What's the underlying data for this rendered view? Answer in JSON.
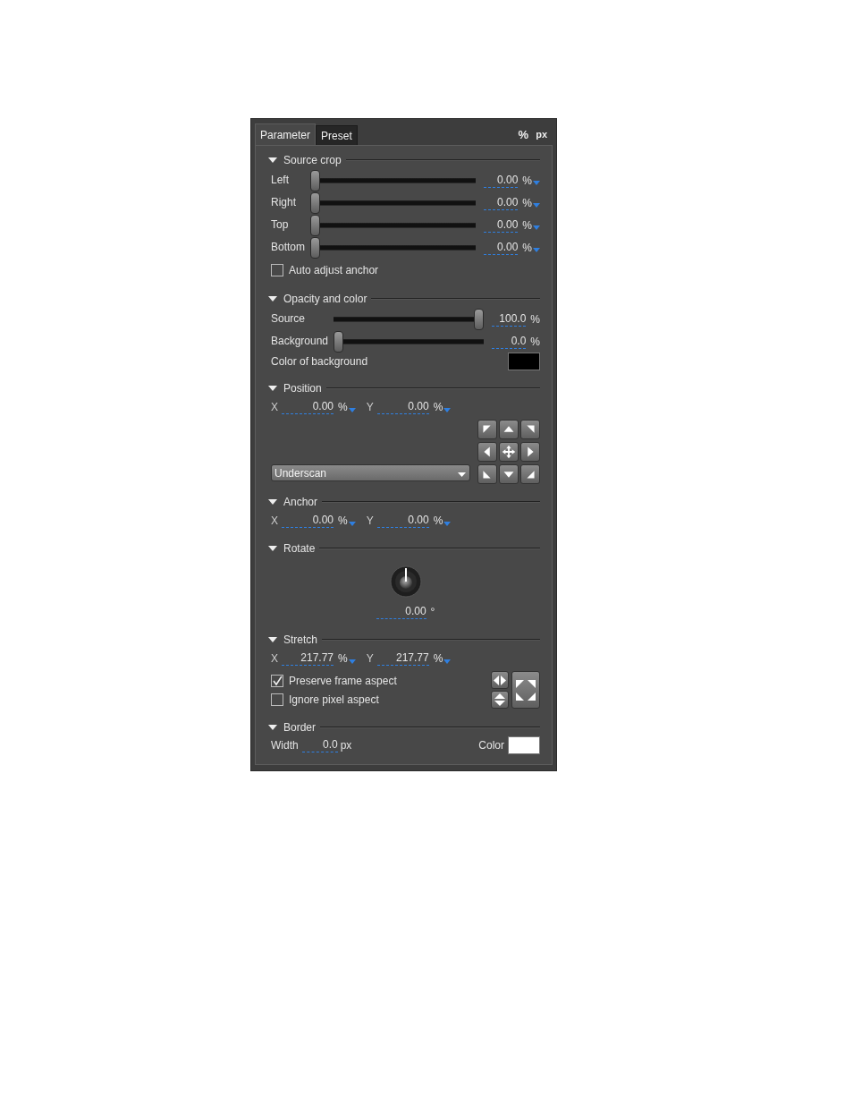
{
  "tabs": [
    {
      "label": "Parameter",
      "selected": true
    },
    {
      "label": "Preset",
      "selected": false
    }
  ],
  "unit_buttons": [
    {
      "label": "%"
    },
    {
      "label": "px"
    }
  ],
  "sections": [
    {
      "title": "Source crop",
      "expanded": true,
      "rows": [
        {
          "kind": "slider",
          "label": "Left",
          "level": 0,
          "value": "0.00",
          "unit": "%",
          "dropdown": true
        },
        {
          "kind": "slider",
          "label": "Right",
          "level": 0,
          "value": "0.00",
          "unit": "%",
          "dropdown": true
        },
        {
          "kind": "slider",
          "label": "Top",
          "level": 0,
          "value": "0.00",
          "unit": "%",
          "dropdown": true
        },
        {
          "kind": "slider",
          "label": "Bottom",
          "level": 0,
          "value": "0.00",
          "unit": "%",
          "dropdown": true
        },
        {
          "kind": "checkbox",
          "label": "Auto adjust anchor",
          "checked": false
        }
      ]
    },
    {
      "title": "Opacity and color",
      "expanded": true,
      "rows": [
        {
          "kind": "slider",
          "label": "Source",
          "level": 1,
          "value": "100.0",
          "unit": "%",
          "dropdown": false
        },
        {
          "kind": "slider",
          "label": "Background",
          "level": 0,
          "value": "0.0",
          "unit": "%",
          "dropdown": false
        },
        {
          "kind": "color",
          "label": "Color of background",
          "color": "#000000"
        }
      ]
    },
    {
      "title": "Position",
      "expanded": true,
      "rows": [
        {
          "kind": "xy",
          "x_label": "X",
          "x_value": "0.00",
          "x_unit": "%",
          "y_label": "Y",
          "y_value": "0.00",
          "y_unit": "%"
        },
        {
          "kind": "placement",
          "dropdown": "Underscan"
        }
      ]
    },
    {
      "title": "Anchor",
      "expanded": true,
      "rows": [
        {
          "kind": "xy",
          "x_label": "X",
          "x_value": "0.00",
          "x_unit": "%",
          "y_label": "Y",
          "y_value": "0.00",
          "y_unit": "%"
        }
      ]
    },
    {
      "title": "Rotate",
      "expanded": true,
      "rows": [
        {
          "kind": "knob",
          "value": "0.00",
          "unit": "°"
        }
      ]
    },
    {
      "title": "Stretch",
      "expanded": true,
      "rows": [
        {
          "kind": "xy",
          "x_label": "X",
          "x_value": "217.77",
          "x_unit": "%",
          "y_label": "Y",
          "y_value": "217.77",
          "y_unit": "%"
        },
        {
          "kind": "aspect",
          "options": [
            {
              "label": "Preserve frame aspect",
              "checked": true
            },
            {
              "label": "Ignore pixel aspect",
              "checked": false
            }
          ]
        }
      ]
    },
    {
      "title": "Border",
      "expanded": true,
      "rows": [
        {
          "kind": "border",
          "label": "Width",
          "value": "0.0",
          "unit": "px",
          "color_label": "Color",
          "color": "#ffffff"
        }
      ]
    }
  ]
}
